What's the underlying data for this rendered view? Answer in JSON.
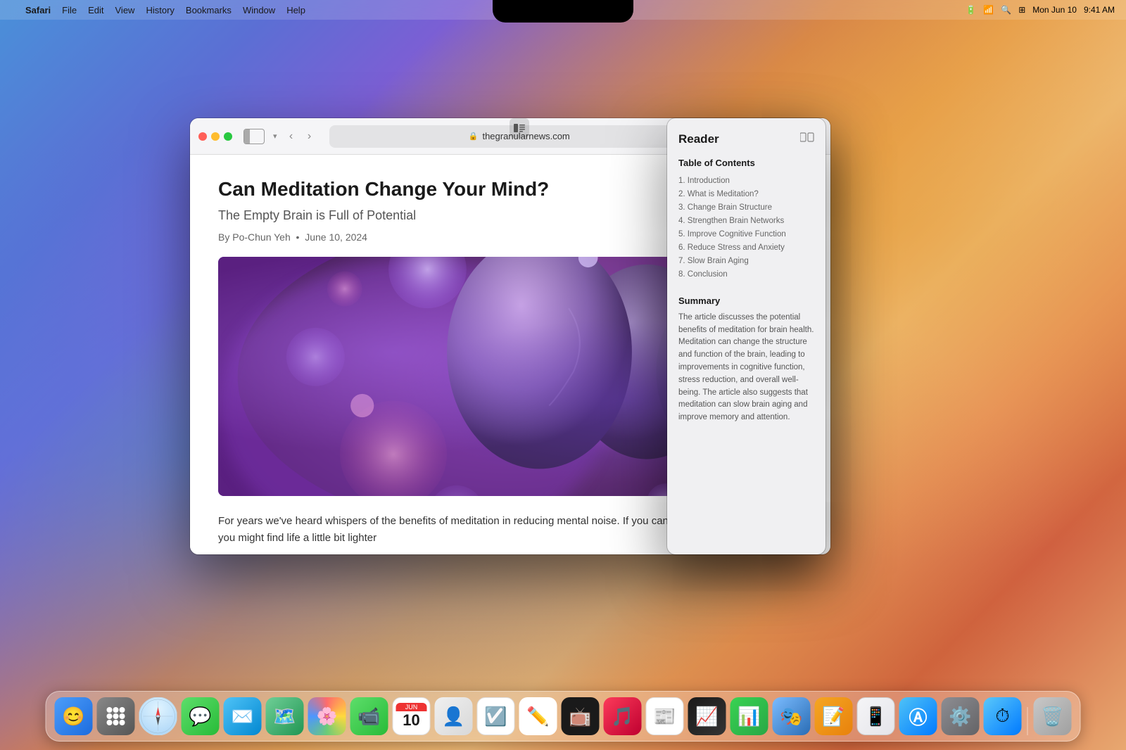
{
  "desktop": {
    "time": "9:41 AM",
    "date": "Mon Jun 10"
  },
  "menubar": {
    "app_name": "Safari",
    "menus": [
      "File",
      "Edit",
      "View",
      "History",
      "Bookmarks",
      "Window",
      "Help"
    ],
    "status_icons": [
      "battery",
      "wifi",
      "search",
      "control-center"
    ]
  },
  "browser": {
    "url": "thegranularnews.com",
    "toolbar": {
      "back_label": "‹",
      "forward_label": "›",
      "share_label": "↑",
      "new_tab_label": "+",
      "tabs_label": "⧉"
    }
  },
  "article": {
    "title": "Can Meditation Change Your Mind?",
    "subtitle": "The Empty Brain is Full of Potential",
    "byline": "By Po-Chun Yeh",
    "date": "June 10, 2024",
    "body_text": "For years we've heard whispers of the benefits of meditation in reducing mental noise. If you can manage to clear your mind, you might find life a little bit lighter"
  },
  "reader": {
    "title": "Reader",
    "toc_title": "Table of Contents",
    "toc_items": [
      "1. Introduction",
      "2. What is Meditation?",
      "3. Change Brain Structure",
      "4. Strengthen Brain Networks",
      "5. Improve Cognitive Function",
      "6. Reduce Stress and Anxiety",
      "7. Slow Brain Aging",
      "8. Conclusion"
    ],
    "summary_title": "Summary",
    "summary_text": "The article discusses the potential benefits of meditation for brain health. Meditation can change the structure and function of the brain, leading to improvements in cognitive function, stress reduction, and overall well-being. The article also suggests that meditation can slow brain aging and improve memory and attention."
  },
  "dock": {
    "apps": [
      {
        "name": "Finder",
        "emoji": "🔵",
        "class": "dock-finder"
      },
      {
        "name": "Launchpad",
        "emoji": "⊞",
        "class": "dock-launchpad"
      },
      {
        "name": "Safari",
        "emoji": "🧭",
        "class": "dock-safari"
      },
      {
        "name": "Messages",
        "emoji": "💬",
        "class": "dock-messages"
      },
      {
        "name": "Mail",
        "emoji": "✉️",
        "class": "dock-mail"
      },
      {
        "name": "Maps",
        "emoji": "🗺",
        "class": "dock-maps"
      },
      {
        "name": "Photos",
        "emoji": "🌸",
        "class": "dock-photos"
      },
      {
        "name": "FaceTime",
        "emoji": "📹",
        "class": "dock-facetime"
      },
      {
        "name": "Calendar",
        "emoji": "📅",
        "class": "dock-calendar"
      },
      {
        "name": "Contacts",
        "emoji": "👤",
        "class": "dock-contacts"
      },
      {
        "name": "Reminders",
        "emoji": "☑️",
        "class": "dock-reminders"
      },
      {
        "name": "Freeform",
        "emoji": "✏️",
        "class": "dock-freeform"
      },
      {
        "name": "Apple TV",
        "emoji": "📺",
        "class": "dock-appletv"
      },
      {
        "name": "Music",
        "emoji": "🎵",
        "class": "dock-music"
      },
      {
        "name": "News",
        "emoji": "📰",
        "class": "dock-news"
      },
      {
        "name": "Stocks",
        "emoji": "📈",
        "class": "dock-stocks"
      },
      {
        "name": "Numbers",
        "emoji": "📊",
        "class": "dock-numbers"
      },
      {
        "name": "Keynote",
        "emoji": "🎭",
        "class": "dock-keynote"
      },
      {
        "name": "Pages",
        "emoji": "📝",
        "class": "dock-pages"
      },
      {
        "name": "iPhone Mirroring",
        "emoji": "📱",
        "class": "dock-iphone-mirroring"
      },
      {
        "name": "App Store",
        "emoji": "Ⓐ",
        "class": "dock-appstore"
      },
      {
        "name": "System Settings",
        "emoji": "⚙️",
        "class": "dock-settings"
      },
      {
        "name": "Screen Time",
        "emoji": "⏱",
        "class": "dock-screentime"
      },
      {
        "name": "Trash",
        "emoji": "🗑",
        "class": "dock-trash"
      }
    ]
  }
}
